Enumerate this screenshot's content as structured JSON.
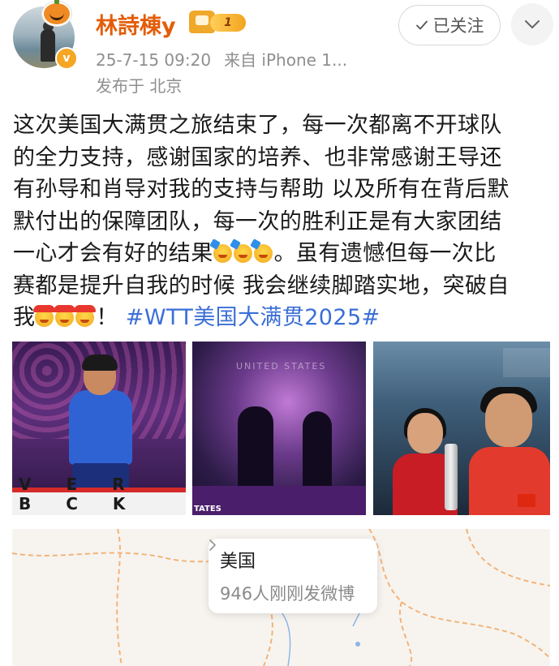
{
  "author": {
    "name": "林詩棟y",
    "vip_level": "1",
    "verified_mark": "v"
  },
  "post_meta": {
    "time": "25-7-15 09:20",
    "source": "来自 iPhone 1...",
    "location": "发布于 北京"
  },
  "actions": {
    "follow_label": "已关注",
    "more_icon": "chevron-down-icon"
  },
  "post": {
    "lines": [
      "这次美国大满贯之旅结束了，每一次都离不开球队",
      "的全力支持，感谢国家的培养、也非常感谢王导还",
      "有孙导和肖导对我的支持与帮助 以及所有在背后默",
      "默付出的保障团队，每一次的胜利正是有大家团结",
      "一心才会有好的结果",
      "。虽有遗憾但每一次比",
      "赛都是提升自我的时候 我会继续脚踏实地，突破自",
      "我",
      "！",
      "#WTT美国大满贯2025#"
    ]
  },
  "photos": {
    "photo1_banner": "V E R B C K",
    "photo2_backdrop": "UNITED STATES",
    "photo2_tag": "TATES"
  },
  "map_card": {
    "country": "美国",
    "count_text": "946人刚刚发微博"
  },
  "colors": {
    "username": "#e35d08",
    "hashtag": "#3b6fd6",
    "meta": "#8f8f8f"
  }
}
